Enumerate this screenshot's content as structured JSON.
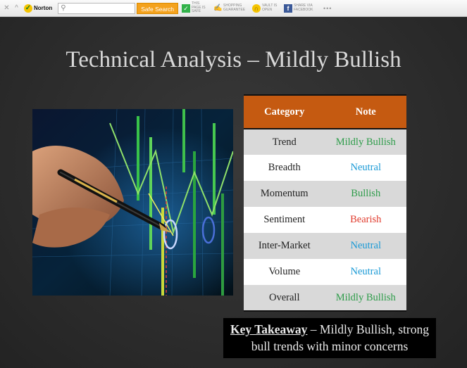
{
  "toolbar": {
    "norton_label": "Norton",
    "search_placeholder": "",
    "safe_search_label": "Safe Search",
    "page_status": "THIS PAGE IS SAFE",
    "shopping_status": "SHOPPING GUARANTEE",
    "vault_status": "VAULT IS OPEN",
    "share_label": "SHARE VIA FACEBOOK",
    "more_label": "•••",
    "colors": {
      "safe_search": "#f4a21d",
      "safe": "#32b24a",
      "facebook": "#3b5998"
    }
  },
  "slide": {
    "title": "Technical Analysis – Mildly Bullish",
    "table": {
      "headers": [
        "Category",
        "Note"
      ],
      "rows": [
        {
          "category": "Trend",
          "note": "Mildly Bullish",
          "color": "#2e9c4a"
        },
        {
          "category": "Breadth",
          "note": "Neutral",
          "color": "#1a9ad6"
        },
        {
          "category": "Momentum",
          "note": "Bullish",
          "color": "#2e9c4a"
        },
        {
          "category": "Sentiment",
          "note": "Bearish",
          "color": "#e03a2c"
        },
        {
          "category": "Inter-Market",
          "note": "Neutral",
          "color": "#1a9ad6"
        },
        {
          "category": "Volume",
          "note": "Neutral",
          "color": "#1a9ad6"
        },
        {
          "category": "Overall",
          "note": "Mildly Bullish",
          "color": "#2e9c4a"
        }
      ],
      "header_color": "#c55a11"
    },
    "takeaway": {
      "label": "Key Takeaway",
      "text_line1": " – Mildly Bullish, strong",
      "text_line2": "bull trends with minor concerns"
    }
  }
}
